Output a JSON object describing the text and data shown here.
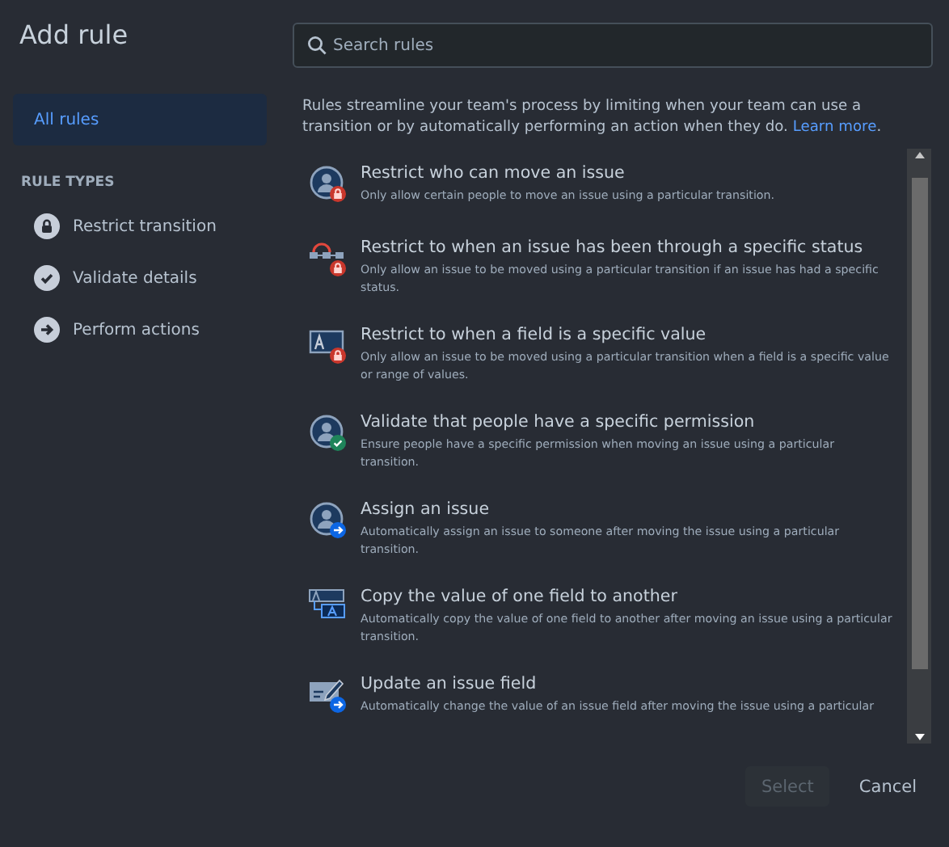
{
  "dialog": {
    "title": "Add rule"
  },
  "sidebar": {
    "items": [
      {
        "label": "All rules",
        "selected": true
      }
    ],
    "section_heading": "RULE TYPES",
    "rule_types": [
      {
        "label": "Restrict transition",
        "kind": "lock",
        "selected": false
      },
      {
        "label": "Validate details",
        "kind": "check",
        "selected": false
      },
      {
        "label": "Perform actions",
        "kind": "arrow",
        "selected": false
      }
    ]
  },
  "search": {
    "placeholder": "Search rules"
  },
  "intro": {
    "text": "Rules streamline your team's process by limiting when your team can use a transition or by automatically performing an action when they do.",
    "link": "Learn more",
    "after": "."
  },
  "rules": [
    {
      "kind": "person-lock",
      "title": "Restrict who can move an issue",
      "description": "Only allow certain people to move an issue using a particular transition."
    },
    {
      "kind": "flow-lock",
      "title": "Restrict to when an issue has been through a specific status",
      "description": "Only allow an issue to be moved using a particular transition if an issue has had a specific status."
    },
    {
      "kind": "field-lock",
      "title": "Restrict to when a field is a specific value",
      "description": "Only allow an issue to be moved using a particular transition when a field is a specific value or range of values."
    },
    {
      "kind": "person-check",
      "title": "Validate that people have a specific permission",
      "description": "Ensure people have a specific permission when moving an issue using a particular transition."
    },
    {
      "kind": "person-arrow",
      "title": "Assign an issue",
      "description": "Automatically assign an issue to someone after moving the issue using a particular transition."
    },
    {
      "kind": "field-copy",
      "title": "Copy the value of one field to another",
      "description": "Automatically copy the value of one field to another after moving an issue using a particular transition."
    },
    {
      "kind": "field-edit",
      "title": "Update an issue field",
      "description": "Automatically change the value of an issue field after moving the issue using a particular"
    }
  ],
  "footer": {
    "buttons": [
      {
        "label": "Select",
        "kind": "primary",
        "disabled": true
      },
      {
        "label": "Cancel",
        "kind": "subtle",
        "disabled": false
      }
    ]
  }
}
